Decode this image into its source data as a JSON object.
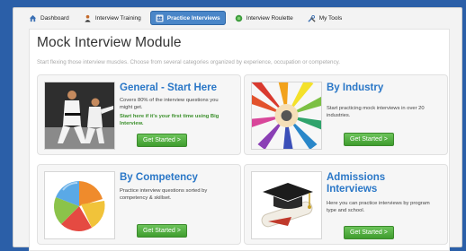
{
  "nav": {
    "tabs": [
      {
        "label": "Dashboard",
        "icon": "house-icon"
      },
      {
        "label": "Interview Training",
        "icon": "person-icon"
      },
      {
        "label": "Practice Interviews",
        "icon": "group-icon",
        "active": true
      },
      {
        "label": "Interview Roulette",
        "icon": "globe-icon"
      },
      {
        "label": "My Tools",
        "icon": "tools-icon"
      }
    ]
  },
  "main": {
    "title": "Mock Interview Module",
    "subtitle": "Start flexing those interview muscles. Choose from several categories organized by experience, occupation or competency."
  },
  "cards": {
    "general": {
      "title": "General - Start Here",
      "desc": "Covers 80% of the interview questions you might get.",
      "note": "Start here if it's your first time using Big Interview.",
      "button": "Get Started >"
    },
    "industry": {
      "title": "By Industry",
      "desc": "Start practicing mock interviews in over 20 industries.",
      "button": "Get Started >"
    },
    "competency": {
      "title": "By Competency",
      "desc": "Practice interview questions sorted by competency & skillset.",
      "button": "Get Started >"
    },
    "admissions": {
      "title": "Admissions Interviews",
      "desc": "Here you can practice interviews by program type and school.",
      "button": "Get Started >"
    }
  },
  "colors": {
    "background": "#2b5fa8",
    "accent_blue": "#2a77c7",
    "button_green": "#3f9c2e"
  }
}
